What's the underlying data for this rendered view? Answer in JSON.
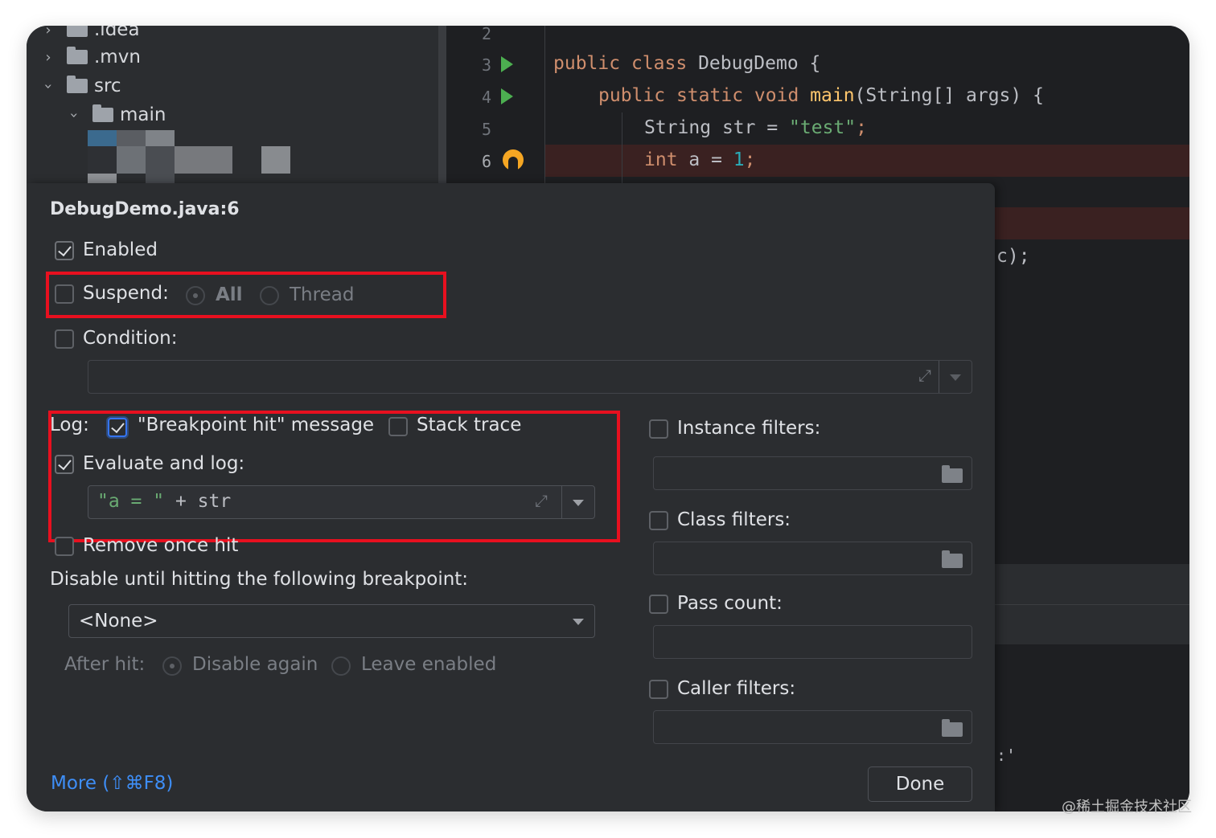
{
  "tree": {
    "items": [
      {
        "name": ".idea",
        "expanded": false
      },
      {
        "name": ".mvn",
        "expanded": false
      },
      {
        "name": "src",
        "expanded": true
      },
      {
        "name": "main",
        "expanded": true
      }
    ]
  },
  "editor": {
    "line_numbers": [
      "2",
      "3",
      "4",
      "5",
      "6"
    ],
    "lines": {
      "l3": {
        "kw1": "public",
        "kw2": "class",
        "name": "DebugDemo",
        "rest": " {"
      },
      "l4": {
        "kw1": "public",
        "kw2": "static",
        "kw3": "void",
        "fn": "main",
        "rest": "(String[] args) {"
      },
      "l5": {
        "type": "String",
        "var": " str = ",
        "str": "\"test\"",
        "end": ";"
      },
      "l6": {
        "kw": "int",
        "var": " a = ",
        "num": "1",
        "end": ";"
      }
    },
    "fragment_1": "c);",
    "fragment_2": ":'"
  },
  "dialog": {
    "title": "DebugDemo.java:6",
    "enabled_label": "Enabled",
    "suspend_label": "Suspend:",
    "suspend_all": "All",
    "suspend_thread": "Thread",
    "condition_label": "Condition:",
    "log_label": "Log:",
    "breakpoint_hit_message": "\"Breakpoint hit\" message",
    "stack_trace_label": "Stack trace",
    "evaluate_and_log_label": "Evaluate and log:",
    "evaluate_expression": {
      "str": "\"a = \"",
      "op": " + ",
      "var": "str"
    },
    "remove_once_hit_label": "Remove once hit",
    "disable_until_label": "Disable until hitting the following breakpoint:",
    "disable_until_value": "<None>",
    "after_hit_label": "After hit:",
    "disable_again_label": "Disable again",
    "leave_enabled_label": "Leave enabled",
    "instance_filters_label": "Instance filters:",
    "class_filters_label": "Class filters:",
    "pass_count_label": "Pass count:",
    "caller_filters_label": "Caller filters:",
    "more_link": "More (⇧⌘F8)",
    "done_button": "Done"
  },
  "watermark": "@稀土掘金技术社区",
  "colors": {
    "highlight_box": "#e8101f",
    "link": "#3e8ef7",
    "breakpoint": "#f5a623",
    "run_gutter": "#4caf50"
  }
}
